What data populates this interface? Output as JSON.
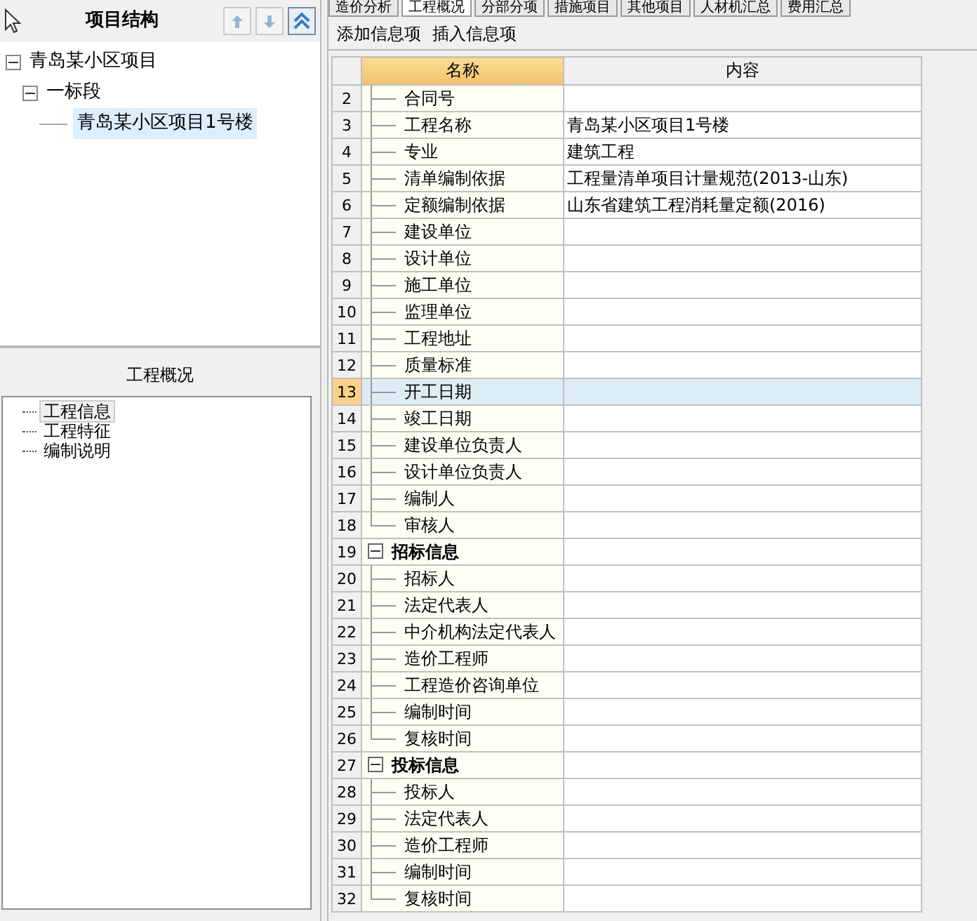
{
  "project_tree": {
    "title": "项目结构",
    "nodes": [
      {
        "label": "青岛某小区项目",
        "expanded": true,
        "selected": false,
        "children": [
          {
            "label": "一标段",
            "expanded": true,
            "selected": false,
            "children": [
              {
                "label": "青岛某小区项目1号楼",
                "selected": true
              }
            ]
          }
        ]
      }
    ]
  },
  "overview": {
    "title": "工程概况",
    "items": [
      {
        "label": "工程信息",
        "selected": true
      },
      {
        "label": "工程特征",
        "selected": false
      },
      {
        "label": "编制说明",
        "selected": false
      }
    ]
  },
  "tabs": [
    {
      "label": "造价分析",
      "selected": false
    },
    {
      "label": "工程概况",
      "selected": true
    },
    {
      "label": "分部分项",
      "selected": false
    },
    {
      "label": "措施项目",
      "selected": false
    },
    {
      "label": "其他项目",
      "selected": false
    },
    {
      "label": "人材机汇总",
      "selected": false
    },
    {
      "label": "费用汇总",
      "selected": false
    }
  ],
  "toolbar": [
    "添加信息项",
    "插入信息项"
  ],
  "grid": {
    "columns": [
      "名称",
      "内容"
    ],
    "rows": [
      {
        "num": "2",
        "kind": "item",
        "name": "合同号",
        "content": "",
        "selected": false
      },
      {
        "num": "3",
        "kind": "item",
        "name": "工程名称",
        "content": "青岛某小区项目1号楼",
        "selected": false
      },
      {
        "num": "4",
        "kind": "item",
        "name": "专业",
        "content": "建筑工程",
        "selected": false
      },
      {
        "num": "5",
        "kind": "item",
        "name": "清单编制依据",
        "content": "工程量清单项目计量规范(2013-山东)",
        "selected": false
      },
      {
        "num": "6",
        "kind": "item",
        "name": "定额编制依据",
        "content": "山东省建筑工程消耗量定额(2016)",
        "selected": false
      },
      {
        "num": "7",
        "kind": "item",
        "name": "建设单位",
        "content": "",
        "selected": false
      },
      {
        "num": "8",
        "kind": "item",
        "name": "设计单位",
        "content": "",
        "selected": false
      },
      {
        "num": "9",
        "kind": "item",
        "name": "施工单位",
        "content": "",
        "selected": false
      },
      {
        "num": "10",
        "kind": "item",
        "name": "监理单位",
        "content": "",
        "selected": false
      },
      {
        "num": "11",
        "kind": "item",
        "name": "工程地址",
        "content": "",
        "selected": false
      },
      {
        "num": "12",
        "kind": "item",
        "name": "质量标准",
        "content": "",
        "selected": false
      },
      {
        "num": "13",
        "kind": "item",
        "name": "开工日期",
        "content": "",
        "selected": true
      },
      {
        "num": "14",
        "kind": "item",
        "name": "竣工日期",
        "content": "",
        "selected": false
      },
      {
        "num": "15",
        "kind": "item",
        "name": "建设单位负责人",
        "content": "",
        "selected": false
      },
      {
        "num": "16",
        "kind": "item",
        "name": "设计单位负责人",
        "content": "",
        "selected": false
      },
      {
        "num": "17",
        "kind": "item",
        "name": "编制人",
        "content": "",
        "selected": false
      },
      {
        "num": "18",
        "kind": "item",
        "name": "审核人",
        "content": "",
        "selected": false
      },
      {
        "num": "19",
        "kind": "group",
        "name": "招标信息",
        "content": "",
        "selected": false,
        "expanded": true
      },
      {
        "num": "20",
        "kind": "item",
        "name": "招标人",
        "content": "",
        "selected": false
      },
      {
        "num": "21",
        "kind": "item",
        "name": "法定代表人",
        "content": "",
        "selected": false
      },
      {
        "num": "22",
        "kind": "item",
        "name": "中介机构法定代表人",
        "content": "",
        "selected": false
      },
      {
        "num": "23",
        "kind": "item",
        "name": "造价工程师",
        "content": "",
        "selected": false
      },
      {
        "num": "24",
        "kind": "item",
        "name": "工程造价咨询单位",
        "content": "",
        "selected": false
      },
      {
        "num": "25",
        "kind": "item",
        "name": "编制时间",
        "content": "",
        "selected": false
      },
      {
        "num": "26",
        "kind": "item",
        "name": "复核时间",
        "content": "",
        "selected": false
      },
      {
        "num": "27",
        "kind": "group",
        "name": "投标信息",
        "content": "",
        "selected": false,
        "expanded": true
      },
      {
        "num": "28",
        "kind": "item",
        "name": "投标人",
        "content": "",
        "selected": false
      },
      {
        "num": "29",
        "kind": "item",
        "name": "法定代表人",
        "content": "",
        "selected": false
      },
      {
        "num": "30",
        "kind": "item",
        "name": "造价工程师",
        "content": "",
        "selected": false
      },
      {
        "num": "31",
        "kind": "item",
        "name": "编制时间",
        "content": "",
        "selected": false
      },
      {
        "num": "32",
        "kind": "item",
        "name": "复核时间",
        "content": "",
        "selected": false
      }
    ]
  }
}
